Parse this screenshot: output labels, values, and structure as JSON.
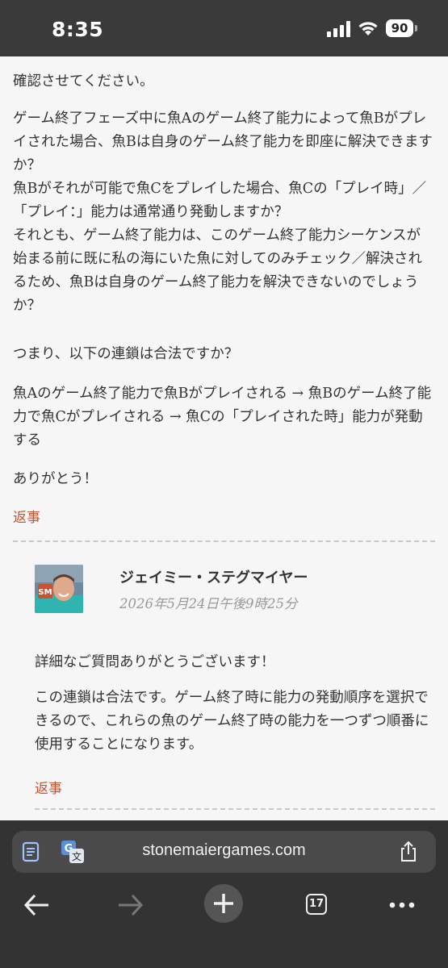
{
  "status_bar": {
    "time": "8:35",
    "battery": "90"
  },
  "comment": {
    "paragraphs": [
      "確認させてください。",
      "ゲーム終了フェーズ中に魚Aのゲーム終了能力によって魚Bがプレイされた場合、魚Bは自身のゲーム終了能力を即座に解決できますか？",
      "魚Bがそれが可能で魚Cをプレイした場合、魚Cの「プレイ時」／「プレイ：」能力は通常通り発動しますか？",
      "それとも、ゲーム終了能力は、このゲーム終了能力シーケンスが始まる前に既に私の海にいた魚に対してのみチェック／解決されるため、魚Bは自身のゲーム終了能力を解決できないのでしょうか？",
      "つまり、以下の連鎖は合法ですか？",
      "魚Aのゲーム終了能力で魚Bがプレイされる → 魚Bのゲーム終了能力で魚Cがプレイされる → 魚Cの「プレイされた時」能力が発動する",
      "ありがとう！"
    ],
    "reply_label": "返事"
  },
  "response": {
    "avatar_text": "SM",
    "author": "ジェイミー・ステグマイヤー",
    "date": "2026年5月24日午後9時25分",
    "paragraphs": [
      "詳細なご質問ありがとうございます！",
      "この連鎖は合法です。ゲーム終了時に能力の発動順序を選択できるので、これらの魚のゲーム終了時の能力を一つずつ順番に使用することになります。"
    ],
    "reply_label": "返事"
  },
  "browser": {
    "url": "stonemaiergames.com",
    "tab_count": "17",
    "icons": [
      "reader-icon",
      "translate-icon",
      "share-icon",
      "back-icon",
      "forward-icon",
      "new-tab-icon",
      "tabs-icon",
      "more-icon"
    ]
  },
  "colors": {
    "accent": "#c8532e",
    "status_bar": "#3a3a3a",
    "toolbar": "#333333"
  }
}
